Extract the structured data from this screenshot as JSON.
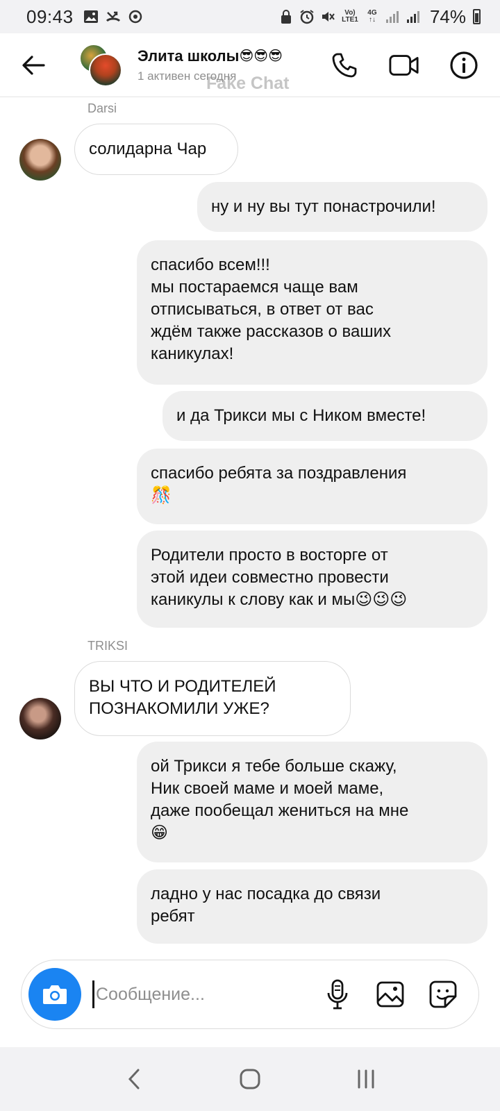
{
  "status_bar": {
    "time": "09:43",
    "network_top": "Vo)",
    "network_bottom": "LTE1",
    "network_gen": "4G",
    "battery": "74%"
  },
  "header": {
    "title": "Элита школы",
    "title_emoji": "😎😎😎",
    "subtitle": "1 активен сегодня",
    "watermark": "Fake Chat"
  },
  "messages": [
    {
      "id": "m1",
      "sender": "Darsi",
      "side": "in",
      "text": "солидарна Чар"
    },
    {
      "id": "m2",
      "side": "out",
      "text": "ну и ну вы тут понастрочили!"
    },
    {
      "id": "m3",
      "side": "out",
      "text": "спасибо всем!!!\nмы постараемся чаще вам\nотписываться, в ответ от вас\nждём также рассказов о ваших\nканикулах!"
    },
    {
      "id": "m4",
      "side": "out",
      "text": "и да Трикси мы с Ником вместе!"
    },
    {
      "id": "m5",
      "side": "out",
      "text": "спасибо ребята за поздравления",
      "emoji": "🎊"
    },
    {
      "id": "m6",
      "side": "out",
      "text": "Родители просто в восторге от\nэтой идеи совместно провести\nканикулы к слову как и мы",
      "emoji": "😉😉😉"
    },
    {
      "id": "m7",
      "sender": "TRIKSI",
      "side": "in",
      "text": "ВЫ ЧТО И РОДИТЕЛЕЙ\nПОЗНАКОМИЛИ УЖЕ?"
    },
    {
      "id": "m8",
      "side": "out",
      "text": "ой Трикси я тебе больше скажу,\nНик своей маме и моей маме,\nдаже пообещал жениться на мне",
      "emoji": "😁"
    },
    {
      "id": "m9",
      "side": "out",
      "text": "ладно у нас посадка до связи\nребят"
    }
  ],
  "composer": {
    "placeholder": "Сообщение..."
  },
  "colors": {
    "accent": "#1a84f2",
    "outgoing_bubble": "#efefef",
    "incoming_border": "#dbdbdb"
  },
  "icons": [
    "back-arrow-icon",
    "phone-icon",
    "video-call-icon",
    "info-icon",
    "camera-icon",
    "microphone-icon",
    "gallery-icon",
    "sticker-icon"
  ]
}
